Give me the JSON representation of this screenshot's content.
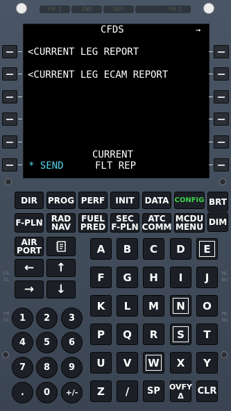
{
  "annunciators": {
    "fm1": "FM 1",
    "ind": "IND",
    "rdy": "RDY",
    "fm2": "FM 2"
  },
  "screen": {
    "title": "CFDS",
    "arrow": "→",
    "l1": "<CURRENT LEG REPORT",
    "l2": "<CURRENT LEG ECAM REPORT",
    "l6_label": "CURRENT",
    "l6_label2": "FLT REP",
    "l6_left": "* SEND"
  },
  "colors": {
    "cyan": "#56d6ee",
    "green": "#3cd24a",
    "white": "#ffffff"
  },
  "function_keys": {
    "dir": "DIR",
    "prog": "PROG",
    "perf": "PERF",
    "init": "INIT",
    "data": "DATA",
    "config": "CONFIG",
    "brt": "BRT",
    "fpln": "F-PLN",
    "rad_nav_1": "RAD",
    "rad_nav_2": "NAV",
    "fuel_pred_1": "FUEL",
    "fuel_pred_2": "PRED",
    "sec_fpln_1": "SEC",
    "sec_fpln_2": "F-PLN",
    "atc_comm_1": "ATC",
    "atc_comm_2": "COMM",
    "mcdu_menu_1": "MCDU",
    "mcdu_menu_2": "MENU",
    "dim": "DIM",
    "airport_1": "AIR",
    "airport_2": "PORT"
  },
  "letters": [
    "A",
    "B",
    "C",
    "D",
    "E",
    "F",
    "G",
    "H",
    "I",
    "J",
    "K",
    "L",
    "M",
    "N",
    "O",
    "P",
    "Q",
    "R",
    "S",
    "T",
    "U",
    "V",
    "W",
    "X",
    "Y",
    "Z",
    "/",
    "SP",
    "OVFY",
    "CLR"
  ],
  "ovfy_2": "Δ",
  "numbers": [
    "1",
    "2",
    "3",
    "4",
    "5",
    "6",
    "7",
    "8",
    "9",
    ".",
    "0",
    "+/-"
  ],
  "arrows": {
    "left": "←",
    "up": "↑",
    "right": "→",
    "down": "↓"
  },
  "side_labels": {
    "fail": "FAIL",
    "fmgc": "FMGC",
    "mcdu": "MCDU",
    "menu": "MENU"
  }
}
